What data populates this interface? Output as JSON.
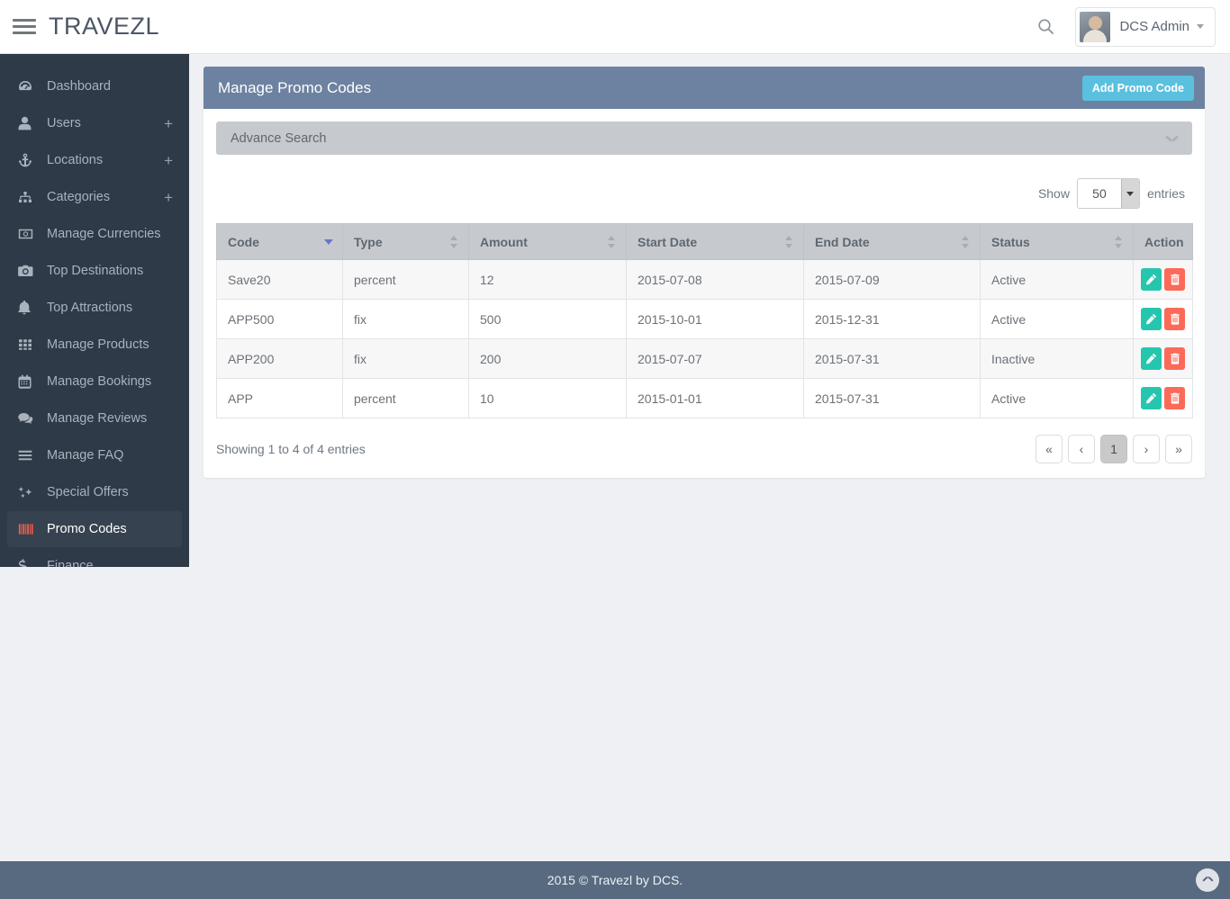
{
  "header": {
    "brand": "TRAVEZL",
    "menu_toggle": "menu",
    "search_icon": "search-icon",
    "user": {
      "name": "DCS Admin"
    }
  },
  "sidebar": {
    "items": [
      {
        "label": "Dashboard",
        "icon": "dashboard-icon",
        "expandable": false,
        "active": false
      },
      {
        "label": "Users",
        "icon": "user-icon",
        "expandable": true,
        "active": false
      },
      {
        "label": "Locations",
        "icon": "anchor-icon",
        "expandable": true,
        "active": false
      },
      {
        "label": "Categories",
        "icon": "sitemap-icon",
        "expandable": true,
        "active": false
      },
      {
        "label": "Manage Currencies",
        "icon": "money-icon",
        "expandable": false,
        "active": false
      },
      {
        "label": "Top Destinations",
        "icon": "camera-icon",
        "expandable": false,
        "active": false
      },
      {
        "label": "Top Attractions",
        "icon": "bell-icon",
        "expandable": false,
        "active": false
      },
      {
        "label": "Manage Products",
        "icon": "grid-icon",
        "expandable": false,
        "active": false
      },
      {
        "label": "Manage Bookings",
        "icon": "calendar-icon",
        "expandable": false,
        "active": false
      },
      {
        "label": "Manage Reviews",
        "icon": "comments-icon",
        "expandable": false,
        "active": false
      },
      {
        "label": "Manage FAQ",
        "icon": "list-icon",
        "expandable": false,
        "active": false
      },
      {
        "label": "Special Offers",
        "icon": "sparkle-icon",
        "expandable": false,
        "active": false
      },
      {
        "label": "Promo Codes",
        "icon": "barcode-icon",
        "expandable": false,
        "active": true
      },
      {
        "label": "Finance",
        "icon": "dollar-icon",
        "expandable": false,
        "active": false
      }
    ],
    "expand_symbol": "+",
    "active_icon_color": "#fd5c4e"
  },
  "panel": {
    "title": "Manage Promo Codes",
    "add_button": "Add Promo Code",
    "header_color": "#6d82a0",
    "add_button_color": "#5bc0de"
  },
  "advance_search": {
    "label": "Advance Search",
    "chevron": "chevron-down-icon"
  },
  "length_menu": {
    "show_label": "Show",
    "value": "50",
    "entries_label": "entries"
  },
  "table": {
    "columns": [
      {
        "label": "Code",
        "sort": "desc"
      },
      {
        "label": "Type",
        "sort": "both"
      },
      {
        "label": "Amount",
        "sort": "both"
      },
      {
        "label": "Start Date",
        "sort": "both"
      },
      {
        "label": "End Date",
        "sort": "both"
      },
      {
        "label": "Status",
        "sort": "both"
      },
      {
        "label": "Action",
        "sort": "none"
      }
    ],
    "rows": [
      {
        "code": "Save20",
        "type": "percent",
        "amount": "12",
        "start": "2015-07-08",
        "end": "2015-07-09",
        "status": "Active"
      },
      {
        "code": "APP500",
        "type": "fix",
        "amount": "500",
        "start": "2015-10-01",
        "end": "2015-12-31",
        "status": "Active"
      },
      {
        "code": "APP200",
        "type": "fix",
        "amount": "200",
        "start": "2015-07-07",
        "end": "2015-07-31",
        "status": "Inactive"
      },
      {
        "code": "APP",
        "type": "percent",
        "amount": "10",
        "start": "2015-01-01",
        "end": "2015-07-31",
        "status": "Active"
      }
    ],
    "action_icons": {
      "edit": "pencil-icon",
      "delete": "trash-icon"
    },
    "edit_color": "#26c6ae",
    "delete_color": "#fb6a58"
  },
  "table_footer": {
    "info": "Showing 1 to 4 of 4 entries",
    "pagination": [
      {
        "label": "«",
        "name": "first",
        "current": false
      },
      {
        "label": "‹",
        "name": "previous",
        "current": false
      },
      {
        "label": "1",
        "name": "page-1",
        "current": true
      },
      {
        "label": "›",
        "name": "next",
        "current": false
      },
      {
        "label": "»",
        "name": "last",
        "current": false
      }
    ]
  },
  "footer": {
    "text": "2015 © Travezl by DCS.",
    "to_top_icon": "chevron-up-icon"
  }
}
